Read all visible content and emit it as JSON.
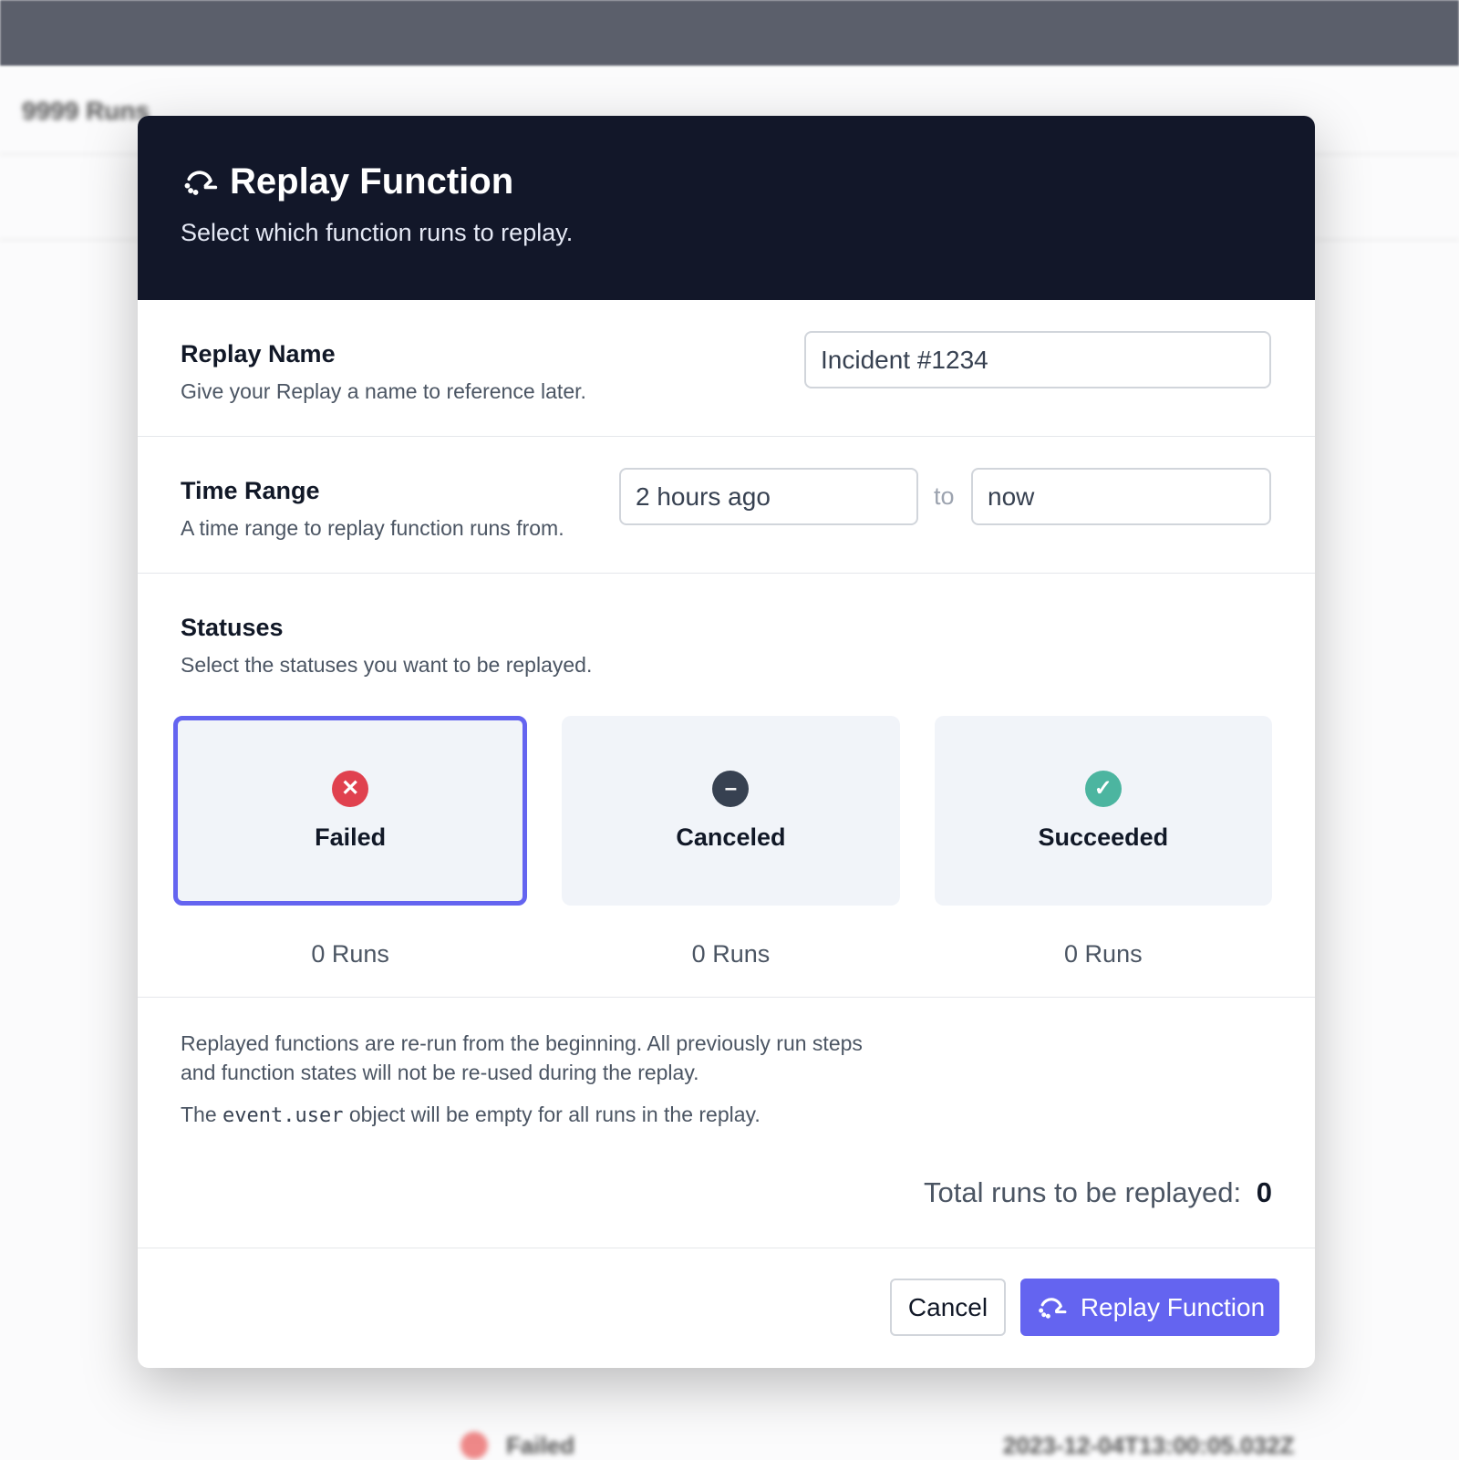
{
  "background": {
    "runs_count": "9999 Runs",
    "row_status": "Failed",
    "row_timestamp": "2023-12-04T13:00:05.032Z"
  },
  "modal": {
    "title": "Replay Function",
    "subtitle": "Select which function runs to replay.",
    "replay_name": {
      "label": "Replay Name",
      "description": "Give your Replay a name to reference later.",
      "value": "Incident #1234"
    },
    "time_range": {
      "label": "Time Range",
      "description": "A time range to replay function runs from.",
      "from": "2 hours ago",
      "separator": "to",
      "to": "now"
    },
    "statuses": {
      "label": "Statuses",
      "description": "Select the statuses you want to be replayed.",
      "items": [
        {
          "label": "Failed",
          "runs": "0 Runs",
          "selected": true,
          "color": "#e0414f"
        },
        {
          "label": "Canceled",
          "runs": "0 Runs",
          "selected": false,
          "color": "#374151"
        },
        {
          "label": "Succeeded",
          "runs": "0 Runs",
          "selected": false,
          "color": "#4cb5a0"
        }
      ]
    },
    "note1": "Replayed functions are re-run from the beginning. All previously run steps and function states will not be re-used during the replay.",
    "note2_pre": "The",
    "note2_code": "event.user",
    "note2_post": "object will be empty for all runs in the replay.",
    "total_label": "Total runs to be replayed:",
    "total_value": "0",
    "cancel": "Cancel",
    "submit": "Replay Function",
    "accent": "#6464f0"
  }
}
